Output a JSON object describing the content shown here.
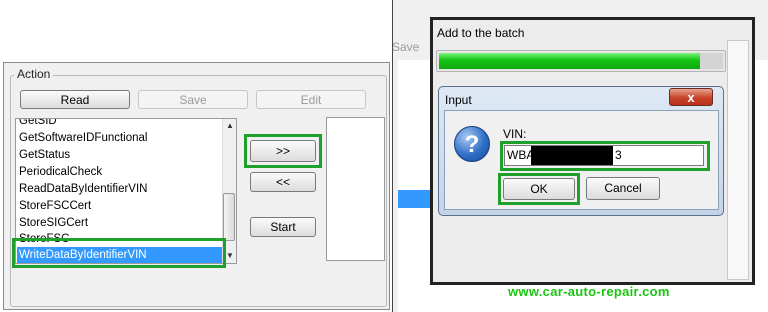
{
  "left_panel": {
    "group_label": "Action",
    "buttons": {
      "read": "Read",
      "save": "Save",
      "edit": "Edit"
    },
    "list_items": [
      "GetSID",
      "GetSoftwareIDFunctional",
      "GetStatus",
      "PeriodicalCheck",
      "ReadDataByIdentifierVIN",
      "StoreFSCCert",
      "StoreSIGCert",
      "StoreFSC",
      "WriteDataByIdentifierVIN"
    ],
    "selected_item": "WriteDataByIdentifierVIN",
    "move_right_label": ">>",
    "move_left_label": "<<",
    "start_label": "Start"
  },
  "right_window": {
    "faint_save_label": "Save",
    "batch_title": "Add to the batch",
    "progress_fraction": 0.92,
    "dialog": {
      "title": "Input",
      "close_label": "x",
      "field_label": "VIN:",
      "vin_prefix": "WBA",
      "vin_suffix": "3",
      "ok_label": "OK",
      "cancel_label": "Cancel"
    }
  },
  "watermark": "www.car-auto-repair.com",
  "colors": {
    "highlight": "#1fa02a",
    "selection": "#3399ff",
    "progress": "#15c415"
  }
}
